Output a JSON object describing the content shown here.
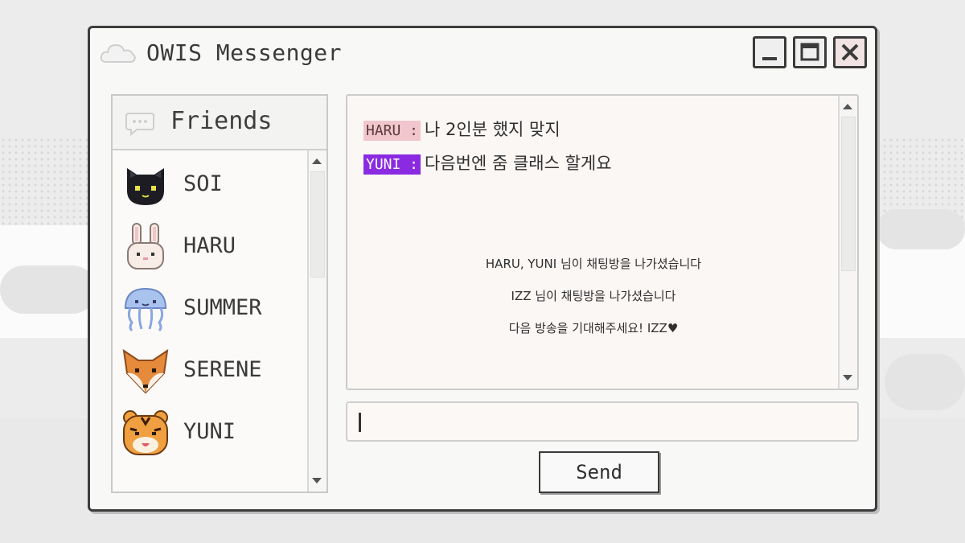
{
  "window": {
    "title": "OWIS Messenger",
    "icon": "cloud-icon",
    "controls": [
      "minimize-icon",
      "maximize-icon",
      "close-icon"
    ]
  },
  "friends": {
    "title": "Friends",
    "icon": "chat-bubble-icon",
    "items": [
      {
        "name": "SOI",
        "avatar": "black-cat-icon"
      },
      {
        "name": "HARU",
        "avatar": "white-rabbit-icon"
      },
      {
        "name": "SUMMER",
        "avatar": "jellyfish-icon"
      },
      {
        "name": "SERENE",
        "avatar": "fox-icon"
      },
      {
        "name": "YUNI",
        "avatar": "tiger-icon"
      }
    ]
  },
  "chat": {
    "messages": [
      {
        "sender": "HARU :",
        "text": "나 2인분 했지 맞지",
        "color": "#f1c6cc"
      },
      {
        "sender": "YUNI :",
        "text": "다음번엔 줌 클래스 할게요",
        "color": "#8a2be2"
      }
    ],
    "system": [
      "HARU, YUNI 님이 채팅방을 나가셨습니다",
      "IZZ 님이 채팅방을 나가셨습니다",
      "다음 방송을 기대해주세요! IZZ♥"
    ]
  },
  "input": {
    "value": "",
    "placeholder": ""
  },
  "send_label": "Send"
}
